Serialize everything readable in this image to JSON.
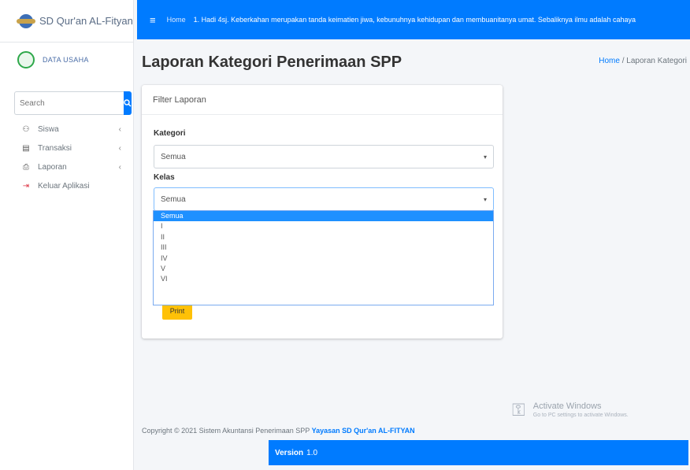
{
  "brand": {
    "name": "SD Qur'an AL-Fityan"
  },
  "user": {
    "name": "DATA USAHA"
  },
  "search": {
    "placeholder": "Search"
  },
  "sidebar": {
    "items": [
      {
        "label": "Siswa",
        "icon": "users-icon",
        "has_submenu": true
      },
      {
        "label": "Transaksi",
        "icon": "book-icon",
        "has_submenu": true
      },
      {
        "label": "Laporan",
        "icon": "print-icon",
        "has_submenu": true
      },
      {
        "label": "Keluar Aplikasi",
        "icon": "logout-icon",
        "has_submenu": false
      }
    ]
  },
  "topbar": {
    "home_label": "Home",
    "marquee_text": "1. Hadi 4sj. Keberkahan merupakan tanda keimatien jiwa, kebunuhnya kehidupan dan membuanitanya umat. Sebaliknya ilmu adalah cahaya"
  },
  "page": {
    "title": "Laporan Kategori Penerimaan SPP",
    "breadcrumb": {
      "home": "Home",
      "separator": "/",
      "current": "Laporan Kategori"
    }
  },
  "form": {
    "card_title": "Filter Laporan",
    "kategori_label": "Kategori",
    "kategori_value": "Semua",
    "kelas_label": "Kelas",
    "kelas_value": "Semua",
    "kelas_options": [
      "Semua",
      "I",
      "II",
      "III",
      "IV",
      "V",
      "VI"
    ],
    "kelas_selected_index": 0,
    "submit_label": "Print"
  },
  "footer": {
    "copyright_text": "Copyright © 2021 Sistem Akuntansi Penerimaan SPP",
    "org_name": "Yayasan SD Qur'an AL-FITYAN",
    "version_label": "Version",
    "version_value": "1.0"
  },
  "watermark": {
    "title": "Activate Windows",
    "subtitle": "Go to PC settings to activate Windows."
  },
  "colors": {
    "primary": "#007bff",
    "warning": "#ffc107",
    "danger": "#dc3545",
    "success": "#2ea84a"
  }
}
